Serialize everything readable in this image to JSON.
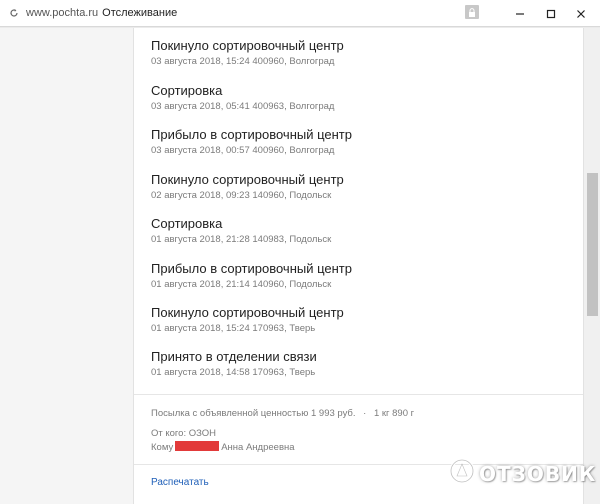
{
  "browser": {
    "url": "www.pochta.ru",
    "page_title": "Отслеживание",
    "icons": {
      "reload": "reload-icon",
      "lock": "lock-icon",
      "minimize": "minimize-icon",
      "maximize": "maximize-icon",
      "close": "close-icon"
    }
  },
  "tracking": {
    "events": [
      {
        "status": "Покинуло сортировочный центр",
        "meta": "03 августа 2018, 15:24 400960, Волгоград"
      },
      {
        "status": "Сортировка",
        "meta": "03 августа 2018, 05:41 400963, Волгоград"
      },
      {
        "status": "Прибыло в сортировочный центр",
        "meta": "03 августа 2018, 00:57 400960, Волгоград"
      },
      {
        "status": "Покинуло сортировочный центр",
        "meta": "02 августа 2018, 09:23 140960, Подольск"
      },
      {
        "status": "Сортировка",
        "meta": "01 августа 2018, 21:28 140983, Подольск"
      },
      {
        "status": "Прибыло в сортировочный центр",
        "meta": "01 августа 2018, 21:14 140960, Подольск"
      },
      {
        "status": "Покинуло сортировочный центр",
        "meta": "01 августа 2018, 15:24 170963, Тверь"
      },
      {
        "status": "Принято в отделении связи",
        "meta": "01 августа 2018, 14:58 170963, Тверь"
      }
    ],
    "parcel": {
      "description": "Посылка с объявленной ценностью 1 993 руб.",
      "separator": "·",
      "weight": "1 кг 890 г",
      "from": "От кого: ОЗОН",
      "to_label": "Кому",
      "to_name": "Анна Андреевна"
    },
    "print_label": "Распечатать"
  },
  "watermark": {
    "text": "ОТЗОВИК",
    "icon": "otzovik-logo-icon"
  },
  "colors": {
    "link": "#1f5fb8",
    "redaction": "#e23a3a"
  }
}
